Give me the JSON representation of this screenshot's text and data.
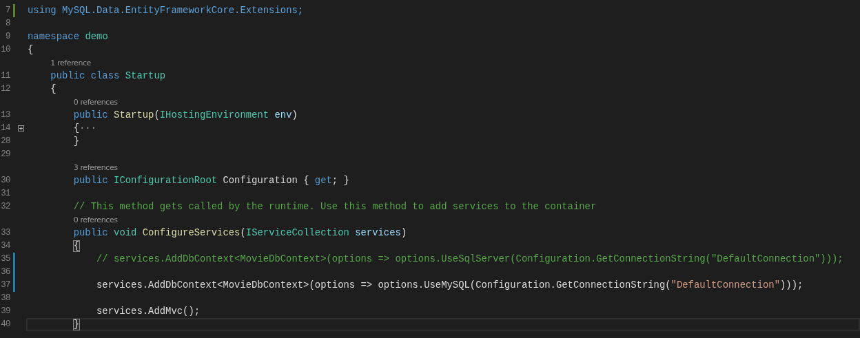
{
  "editor": {
    "lines": [
      {
        "number": "7",
        "color": "#57812a",
        "folded": false,
        "current": false,
        "tokens": [
          {
            "text": "using ",
            "kind": "keyword"
          },
          {
            "text": "MySQL.Data.EntityFrameworkCore.Extensions;",
            "kind": "namespace"
          }
        ]
      },
      {
        "number": "8",
        "folded": false,
        "current": false
      },
      {
        "number": "9",
        "folded": false,
        "current": false,
        "tokens": [
          {
            "text": "namespace ",
            "kind": "keyword"
          },
          {
            "text": "demo",
            "kind": "type"
          }
        ]
      },
      {
        "number": "10",
        "folded": false,
        "current": false,
        "tokens": [
          {
            "text": "{",
            "kind": "plain"
          }
        ]
      },
      {
        "number": "11",
        "folded": false,
        "current": false,
        "codelens": "1 reference",
        "tokens": [
          {
            "text": "    public class ",
            "kind": "keyword"
          },
          {
            "text": "Startup",
            "kind": "type"
          }
        ]
      },
      {
        "number": "12",
        "folded": false,
        "current": false,
        "tokens": [
          {
            "text": "    {",
            "kind": "plain"
          }
        ]
      },
      {
        "number": "13",
        "folded": false,
        "current": false,
        "codelens": "0 references",
        "tokens": [
          {
            "text": "        public ",
            "kind": "keyword"
          },
          {
            "text": "Startup",
            "kind": "method"
          },
          {
            "text": "(",
            "kind": "plain"
          },
          {
            "text": "IHostingEnvironment ",
            "kind": "type"
          },
          {
            "text": "env",
            "kind": "param"
          },
          {
            "text": ")",
            "kind": "plain"
          }
        ]
      },
      {
        "number": "14",
        "folded": true,
        "current": false,
        "tokens": [
          {
            "text": "        {",
            "kind": "plain"
          },
          {
            "text": "···",
            "kind": "collapsed"
          }
        ]
      },
      {
        "number": "28",
        "folded": false,
        "current": false,
        "tokens": [
          {
            "text": "        }",
            "kind": "plain"
          }
        ]
      },
      {
        "number": "29",
        "folded": false,
        "current": false
      },
      {
        "number": "30",
        "folded": false,
        "current": false,
        "codelens": "3 references",
        "tokens": [
          {
            "text": "        public ",
            "kind": "keyword"
          },
          {
            "text": "IConfigurationRoot ",
            "kind": "type"
          },
          {
            "text": "Configuration { ",
            "kind": "plain"
          },
          {
            "text": "get",
            "kind": "keyword"
          },
          {
            "text": "; }",
            "kind": "plain"
          }
        ]
      },
      {
        "number": "31",
        "folded": false,
        "current": false
      },
      {
        "number": "32",
        "folded": false,
        "current": false,
        "tokens": [
          {
            "text": "        // This method gets called by the runtime. Use this method to add services to the container",
            "kind": "comment"
          }
        ]
      },
      {
        "number": "33",
        "folded": false,
        "current": false,
        "codelens": "0 references",
        "tokens": [
          {
            "text": "        public ",
            "kind": "keyword"
          },
          {
            "text": "void ",
            "kind": "type"
          },
          {
            "text": "ConfigureServices",
            "kind": "method"
          },
          {
            "text": "(",
            "kind": "plain"
          },
          {
            "text": "IServiceCollection ",
            "kind": "type"
          },
          {
            "text": "services",
            "kind": "param"
          },
          {
            "text": ")",
            "kind": "plain"
          }
        ]
      },
      {
        "number": "34",
        "folded": false,
        "current": false,
        "tokens": [
          {
            "text": "        {",
            "kind": "brace-match"
          }
        ]
      },
      {
        "number": "35",
        "color": "#1f7ea3",
        "folded": false,
        "current": false,
        "tokens": [
          {
            "text": "            // services.AddDbContext<MovieDbContext>(options => options.UseSqlServer(Configuration.GetConnectionString(\"DefaultConnection\")));",
            "kind": "comment"
          }
        ]
      },
      {
        "number": "36",
        "color": "#1f7ea3",
        "folded": false,
        "current": false
      },
      {
        "number": "37",
        "color": "#1f7ea3",
        "folded": false,
        "current": false,
        "tokens": [
          {
            "text": "            services.AddDbContext<MovieDbContext>(options => options.UseMySQL(Configuration.GetConnectionString(",
            "kind": "plain"
          },
          {
            "text": "\"DefaultConnection\"",
            "kind": "string"
          },
          {
            "text": ")));",
            "kind": "plain"
          }
        ]
      },
      {
        "number": "38",
        "folded": false,
        "current": false
      },
      {
        "number": "39",
        "folded": false,
        "current": false,
        "tokens": [
          {
            "text": "            services.AddMvc();",
            "kind": "plain"
          }
        ]
      },
      {
        "number": "40",
        "folded": false,
        "current": true,
        "tokens": [
          {
            "text": "        }",
            "kind": "brace-match"
          }
        ]
      }
    ]
  }
}
